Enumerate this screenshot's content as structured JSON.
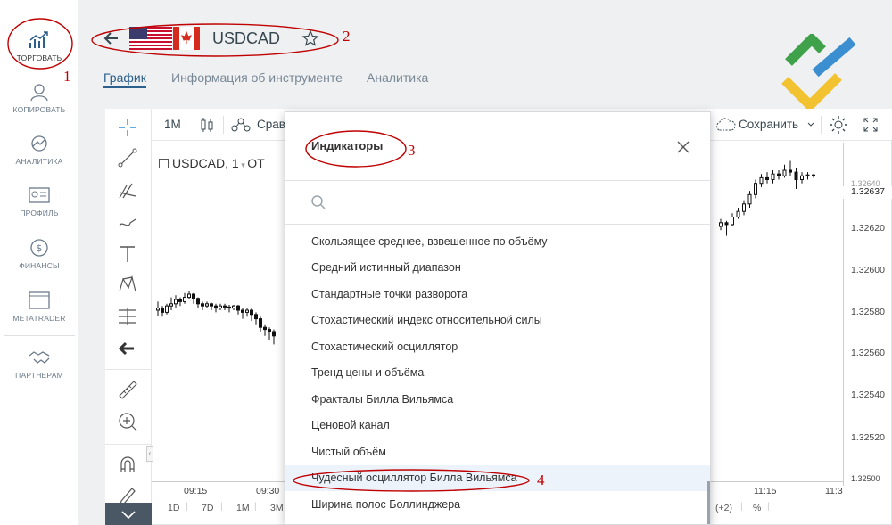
{
  "sidebar": {
    "items": [
      {
        "label": "Торговать",
        "icon": "chart-up-icon"
      },
      {
        "label": "Копировать",
        "icon": "user-icon"
      },
      {
        "label": "Аналитика",
        "icon": "analytics-icon"
      },
      {
        "label": "Профиль",
        "icon": "id-card-icon"
      },
      {
        "label": "Финансы",
        "icon": "dollar-icon"
      },
      {
        "label": "MetaTrader",
        "icon": "window-icon"
      },
      {
        "label": "Партнерам",
        "icon": "handshake-icon"
      }
    ]
  },
  "header": {
    "instrument": "USDCAD",
    "tabs": [
      "График",
      "Информация об инструменте",
      "Аналитика"
    ],
    "active_tab": "График"
  },
  "toolbar": {
    "interval": "1M",
    "compare_label": "Срав",
    "save_label": "Сохранить"
  },
  "chart": {
    "legend": "USDCAD, 1",
    "legend_suffix": "OT",
    "price_tag": "1.32637",
    "price_axis": [
      "1.32620",
      "1.32600",
      "1.32580",
      "1.32560",
      "1.32540",
      "1.32520",
      "1.32500"
    ],
    "time_axis": [
      "09:15",
      "09:30",
      "11:15",
      "11:3"
    ],
    "ranges": [
      "1D",
      "7D",
      "1M",
      "3M"
    ],
    "bottom_right": [
      "(+2)",
      "%"
    ],
    "price_top_partial": "1.32640"
  },
  "modal": {
    "title": "Индикаторы",
    "search_placeholder": "",
    "items": [
      "Скользящее среднее, взвешенное по объёму",
      "Средний истинный диапазон",
      "Стандартные точки разворота",
      "Стохастический индекс относительной силы",
      "Стохастический осциллятор",
      "Тренд цены и объёма",
      "Фракталы Билла Вильямса",
      "Ценовой канал",
      "Чистый объём",
      "Чудесный осциллятор Билла Вильямса",
      "Ширина полос Боллинджера"
    ],
    "highlighted_index": 9
  },
  "annotations": [
    "1",
    "2",
    "3",
    "4"
  ],
  "colors": {
    "accent": "#2b5f8c",
    "annotation": "#c00000"
  }
}
